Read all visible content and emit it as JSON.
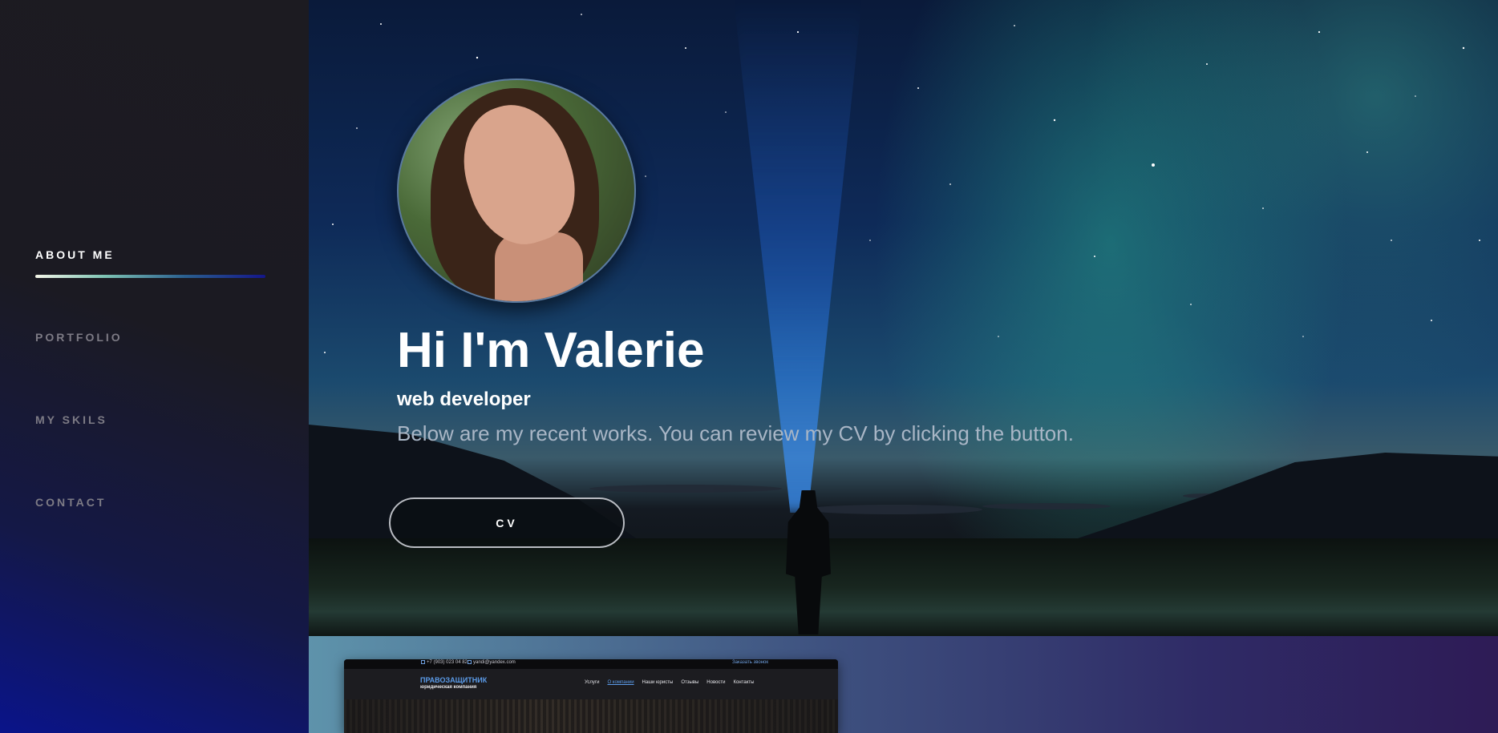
{
  "sidebar": {
    "items": [
      {
        "label": "ABOUT ME",
        "active": true
      },
      {
        "label": "PORTFOLIO",
        "active": false
      },
      {
        "label": "MY SKILS",
        "active": false
      },
      {
        "label": "CONTACT",
        "active": false
      }
    ]
  },
  "hero": {
    "title": "Hi I'm Valerie",
    "subtitle": "web developer",
    "description": "Below are my recent works. You can review my CV by clicking the button.",
    "cv_button": "CV"
  },
  "portfolio": {
    "project": {
      "phone": "+7 (903) 023 04 82",
      "email": "yandi@yandex.com",
      "callback": "Заказать звонок",
      "brand": "ПРАВОЗАЩИТНИК",
      "brand_sub": "юридическая компания",
      "menu": [
        "Услуги",
        "О компании",
        "Наши юристы",
        "Отзывы",
        "Новости",
        "Контакты"
      ]
    }
  },
  "colors": {
    "accent": "#5b9be8",
    "sidebar_bg": "#1c1b21",
    "nav_inactive": "#7d7b85"
  }
}
